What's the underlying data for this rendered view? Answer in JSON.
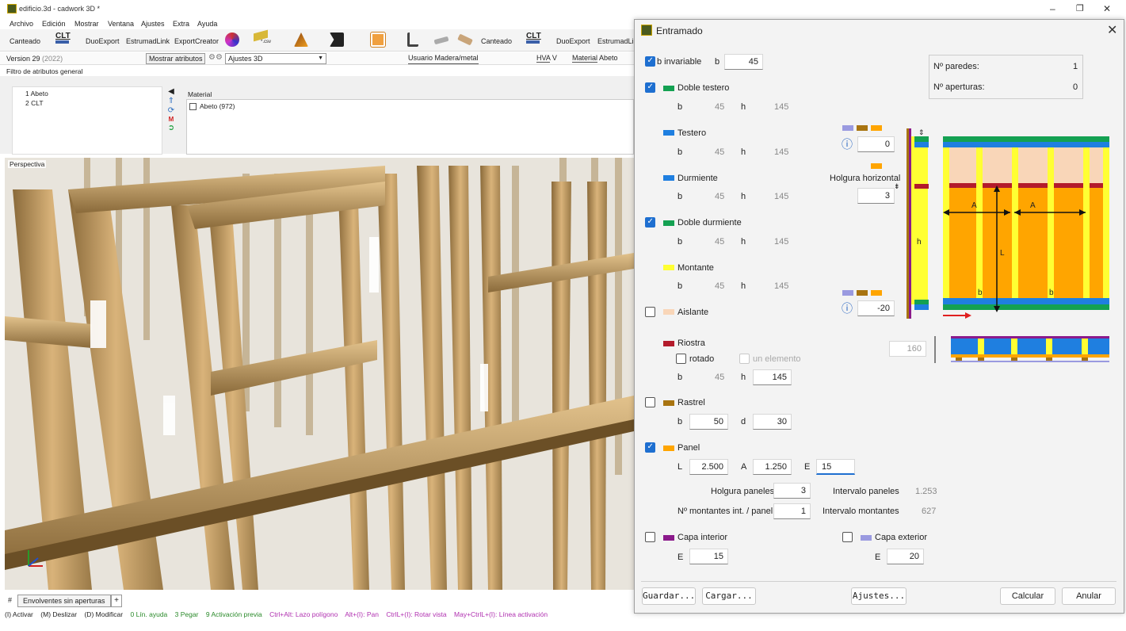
{
  "app": {
    "title": "edificio.3d - cadwork 3D *",
    "menu": [
      "Archivo",
      "Edición",
      "Mostrar",
      "Ventana",
      "Ajustes",
      "Extra",
      "Ayuda"
    ],
    "toolbar": {
      "canteado": "Canteado",
      "clt": "CLT",
      "duoexport": "DuoExport",
      "estrumadlink": "EstrumadLink",
      "exportcreator": "ExportCreator",
      "csv": "*.csv",
      "canteado2": "Canteado",
      "clt2": "CLT",
      "duoexport2": "DuoExport",
      "estrumadlink2": "EstrumadLi"
    },
    "row2": {
      "version": "Version 29",
      "version_year": "(2022)",
      "show_attrs": "Mostrar atributos",
      "settings_3d": "Ajustes 3D",
      "usuario": "Usuario",
      "usuario_value": "Madera/metal",
      "hva": "HVA",
      "v": "V",
      "material": "Material",
      "material_value": "Abeto"
    },
    "filter_label": "Filtro de atributos general",
    "attr_list": [
      "1 Abeto",
      "2 CLT"
    ],
    "material_header": "Material",
    "material_items": [
      "Abeto (972)"
    ],
    "viewport_label": "Perspectiva",
    "tab": "Envolventes sin aperturas",
    "tab_add": "+",
    "tab_hash": "#",
    "status": [
      {
        "text": "(I) Activar",
        "color": "#222"
      },
      {
        "text": "(M) Deslizar",
        "color": "#222"
      },
      {
        "text": "(D) Modificar",
        "color": "#222"
      },
      {
        "text": "0 Lín. ayuda",
        "color": "#2a8a2a"
      },
      {
        "text": "3 Pegar",
        "color": "#2a8a2a"
      },
      {
        "text": "9 Activación previa",
        "color": "#2a8a2a"
      },
      {
        "text": "Ctrl+Alt: Lazo polígono",
        "color": "#b030b0"
      },
      {
        "text": "Alt+(I): Pan",
        "color": "#b030b0"
      },
      {
        "text": "CtrlL+(I): Rotar vista",
        "color": "#b030b0"
      },
      {
        "text": "May+CtrlL+(I): Línea activación",
        "color": "#b030b0"
      }
    ]
  },
  "dialog": {
    "title": "Entramado",
    "b_invariable": "b invariable",
    "b_label": "b",
    "b_value": "45",
    "n_paredes_label": "Nº paredes:",
    "n_paredes": "1",
    "n_aperturas_label": "Nº aperturas:",
    "n_aperturas": "0",
    "rows": {
      "doble_testero": {
        "label": "Doble testero",
        "b": "45",
        "h": "145"
      },
      "testero": {
        "label": "Testero",
        "b": "45",
        "h": "145"
      },
      "durmiente": {
        "label": "Durmiente",
        "b": "45",
        "h": "145"
      },
      "doble_durmiente": {
        "label": "Doble durmiente",
        "b": "45",
        "h": "145"
      },
      "montante": {
        "label": "Montante",
        "b": "45",
        "h": "145"
      },
      "aislante": {
        "label": "Aislante"
      },
      "riostra": {
        "label": "Riostra",
        "rotado": "rotado",
        "un_elemento": "un elemento",
        "b": "45",
        "h": "145"
      },
      "rastrel": {
        "label": "Rastrel",
        "b": "50",
        "d": "30"
      },
      "panel": {
        "label": "Panel",
        "L": "2.500",
        "A": "1.250",
        "E": "15"
      }
    },
    "letters": {
      "b": "b",
      "h": "h",
      "d": "d",
      "L": "L",
      "A": "A",
      "E": "E"
    },
    "holgura_paneles_label": "Holgura paneles",
    "holgura_paneles": "3",
    "intervalo_paneles_label": "Intervalo paneles",
    "intervalo_paneles": "1.253",
    "n_montantes_label": "Nº montantes int. / panel",
    "n_montantes": "1",
    "intervalo_montantes_label": "Intervalo montantes",
    "intervalo_montantes": "627",
    "capa_interior": {
      "label": "Capa interior",
      "E": "15"
    },
    "capa_exterior": {
      "label": "Capa exterior",
      "E": "20"
    },
    "diagram": {
      "top_offset": "0",
      "holgura_horizontal_label": "Holgura horizontal",
      "holgura_horizontal": "3",
      "bottom_offset": "-20",
      "section_value": "160",
      "label_h": "h",
      "label_A1": "A",
      "label_A2": "A",
      "label_L": "L",
      "label_b1": "b",
      "label_b2": "b"
    },
    "buttons": {
      "guardar": "Guardar...",
      "cargar": "Cargar...",
      "ajustes": "Ajustes...",
      "calcular": "Calcular",
      "anular": "Anular"
    },
    "colors": {
      "green": "#14a152",
      "blue": "#1f7fe0",
      "yellow": "#ffff33",
      "insulation": "#f9d6b8",
      "red": "#b31b2b",
      "brown": "#a87410",
      "orange": "#ffa500",
      "purple": "#8b1a8b",
      "lavender": "#9a9ae0",
      "check": "#1e6fd0"
    }
  }
}
